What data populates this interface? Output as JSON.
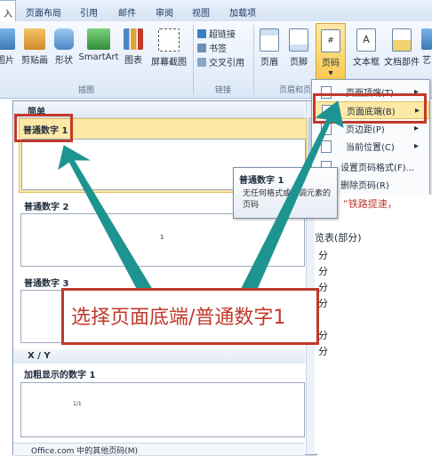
{
  "tabs": [
    "入",
    "页面布局",
    "引用",
    "邮件",
    "审阅",
    "视图",
    "加载项"
  ],
  "ribbon": {
    "buttons": [
      "图片",
      "剪贴画",
      "形状",
      "SmartArt",
      "图表",
      "屏幕截图",
      "页眉",
      "页脚",
      "页码",
      "文本框",
      "文档部件",
      "艺"
    ],
    "links": [
      "超链接",
      "书签",
      "交叉引用"
    ],
    "groups": [
      "插图",
      "链接",
      "页眉和页"
    ]
  },
  "gallery": {
    "header": "简单",
    "items": [
      {
        "label": "普通数字 1",
        "sample": ""
      },
      {
        "label": "普通数字 2",
        "sample": "1"
      },
      {
        "label": "普通数字 3",
        "sample": ""
      }
    ],
    "section2": "X / Y",
    "item4": {
      "label": "加粗显示的数字 1",
      "sample": "1/1"
    },
    "footer": "Office.com 中的其他页码(M)"
  },
  "tooltip": {
    "title": "普通数字 1",
    "body": "无任何格式或强调元素的页码"
  },
  "dropdown": {
    "items": [
      {
        "label": "页面顶端",
        "key": "(T)"
      },
      {
        "label": "页面底端",
        "key": "(B)"
      },
      {
        "label": "页边距",
        "key": "(P)"
      },
      {
        "label": "当前位置",
        "key": "(C)"
      },
      {
        "label": "设置页码格式",
        "key": "(F)..."
      },
      {
        "label": "删除页码",
        "key": "(R)"
      }
    ]
  },
  "document": {
    "lines": [
      "航，“铁路提速，",
      "览表(部分)",
      "分",
      "分",
      "分",
      "分",
      "分",
      "分"
    ]
  },
  "annotation": {
    "text": "选择页面底端/普通数字1"
  },
  "colors": {
    "annotation": "#c0392b",
    "arrow": "#1e9490"
  }
}
